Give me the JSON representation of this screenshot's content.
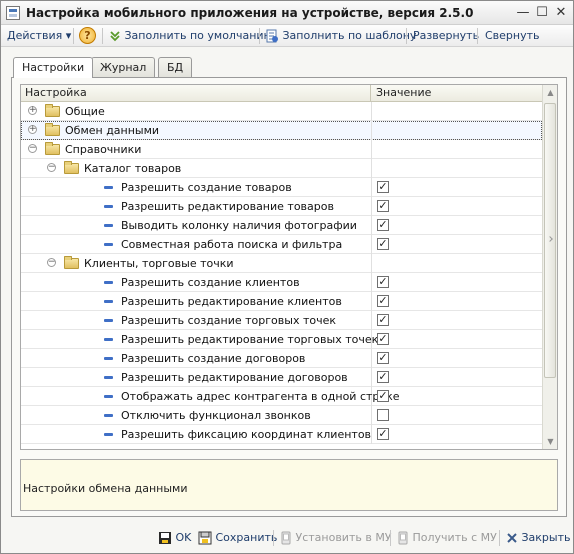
{
  "window": {
    "title": "Настройка мобильного приложения на устройстве, версия 2.5.0",
    "minimize_glyph": "—",
    "maximize_glyph": "☐",
    "close_glyph": "✕"
  },
  "toolbar": {
    "actions_label": "Действия ▾",
    "help_glyph": "?",
    "fill_default_label": "Заполнить по умолчанию",
    "fill_template_label": "Заполнить по шаблону",
    "expand_label": "Развернуть",
    "collapse_label": "Свернуть"
  },
  "tabs": [
    {
      "label": "Настройки",
      "active": true
    },
    {
      "label": "Журнал",
      "active": false
    },
    {
      "label": "БД",
      "active": false
    }
  ],
  "grid": {
    "columns": {
      "setting": "Настройка",
      "value": "Значение"
    },
    "rows": [
      {
        "label": "Общие",
        "kind": "folder",
        "level": 0,
        "expander": "+"
      },
      {
        "label": "Обмен данными",
        "kind": "folder",
        "level": 0,
        "expander": "+",
        "selected": true
      },
      {
        "label": "Справочники",
        "kind": "folder",
        "level": 0,
        "expander": "−"
      },
      {
        "label": "Каталог товаров",
        "kind": "folder",
        "level": 1,
        "expander": "−"
      },
      {
        "label": "Разрешить создание товаров",
        "kind": "setting",
        "level": 2,
        "checked": true
      },
      {
        "label": "Разрешить редактирование товаров",
        "kind": "setting",
        "level": 2,
        "checked": true
      },
      {
        "label": "Выводить колонку наличия фотографии",
        "kind": "setting",
        "level": 2,
        "checked": true
      },
      {
        "label": "Совместная работа поиска и фильтра",
        "kind": "setting",
        "level": 2,
        "checked": true
      },
      {
        "label": "Клиенты, торговые точки",
        "kind": "folder",
        "level": 1,
        "expander": "−"
      },
      {
        "label": "Разрешить создание клиентов",
        "kind": "setting",
        "level": 2,
        "checked": true
      },
      {
        "label": "Разрешить редактирование клиентов",
        "kind": "setting",
        "level": 2,
        "checked": true
      },
      {
        "label": "Разрешить создание торговых точек",
        "kind": "setting",
        "level": 2,
        "checked": true
      },
      {
        "label": "Разрешить редактирование торговых точек",
        "kind": "setting",
        "level": 2,
        "checked": true
      },
      {
        "label": "Разрешить создание договоров",
        "kind": "setting",
        "level": 2,
        "checked": true
      },
      {
        "label": "Разрешить редактирование договоров",
        "kind": "setting",
        "level": 2,
        "checked": true
      },
      {
        "label": "Отображать адрес контрагента в одной строке",
        "kind": "setting",
        "level": 2,
        "checked": true
      },
      {
        "label": "Отключить функционал звонков",
        "kind": "setting",
        "level": 2,
        "checked": false
      },
      {
        "label": "Разрешить фиксацию координат клиентов",
        "kind": "setting",
        "level": 2,
        "checked": true
      }
    ]
  },
  "description": {
    "text": "Настройки обмена данными"
  },
  "buttons": {
    "ok_label": "OK",
    "save_label": "Сохранить",
    "install_label": "Установить в МУ",
    "receive_label": "Получить с МУ",
    "close_label": "Закрыть"
  },
  "colors": {
    "accent": "#1f3d6b",
    "bullet": "#3f6fc6",
    "description_bg": "#fdfbe6"
  }
}
